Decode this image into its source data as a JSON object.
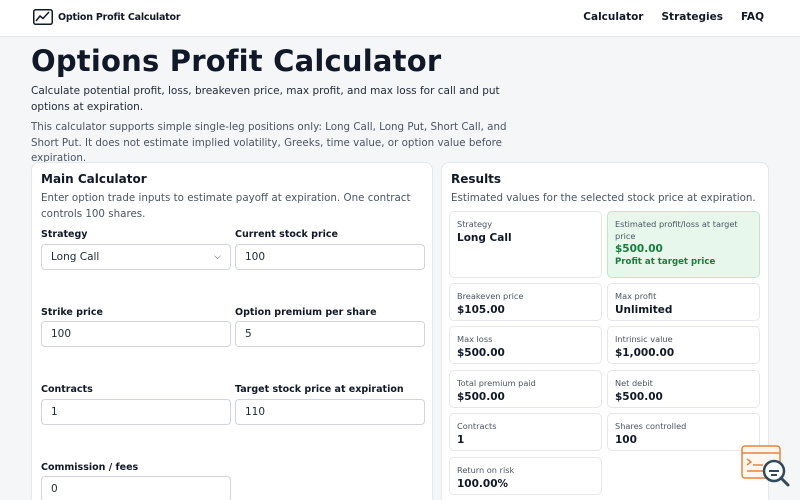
{
  "app": {
    "name": "Option Profit Calculator"
  },
  "nav": {
    "items": [
      "Calculator",
      "Strategies",
      "FAQ"
    ]
  },
  "page": {
    "title": "Options Profit Calculator",
    "intro": "Calculate potential profit, loss, breakeven price, max profit, and max loss for call and put options at expiration.",
    "note": "This calculator supports simple single-leg positions only: Long Call, Long Put, Short Call, and Short Put. It does not estimate implied volatility, Greeks, time value, or option value before expiration."
  },
  "calculator": {
    "title": "Main Calculator",
    "description": "Enter option trade inputs to estimate payoff at expiration. One contract controls 100 shares.",
    "fields": {
      "strategy": {
        "label": "Strategy",
        "value": "Long Call"
      },
      "current_price": {
        "label": "Current stock price",
        "value": "100"
      },
      "strike": {
        "label": "Strike price",
        "value": "100"
      },
      "premium": {
        "label": "Option premium per share",
        "value": "5"
      },
      "contracts": {
        "label": "Contracts",
        "value": "1"
      },
      "target_price": {
        "label": "Target stock price at expiration",
        "value": "110"
      },
      "commission": {
        "label": "Commission / fees",
        "value": "0"
      }
    }
  },
  "results": {
    "title": "Results",
    "description": "Estimated values for the selected stock price at expiration.",
    "tiles": {
      "strategy": {
        "label": "Strategy",
        "value": "Long Call"
      },
      "profit": {
        "label": "Estimated profit/loss at target price",
        "value": "$500.00",
        "sub": "Profit at target price"
      },
      "breakeven": {
        "label": "Breakeven price",
        "value": "$105.00"
      },
      "max_profit": {
        "label": "Max profit",
        "value": "Unlimited"
      },
      "max_loss": {
        "label": "Max loss",
        "value": "$500.00"
      },
      "intrinsic": {
        "label": "Intrinsic value",
        "value": "$1,000.00"
      },
      "total_premium": {
        "label": "Total premium paid",
        "value": "$500.00"
      },
      "net_debit": {
        "label": "Net debit",
        "value": "$500.00"
      },
      "contracts": {
        "label": "Contracts",
        "value": "1"
      },
      "shares": {
        "label": "Shares controlled",
        "value": "100"
      },
      "return_on_risk": {
        "label": "Return on risk",
        "value": "100.00%"
      }
    }
  },
  "colors": {
    "accent_green": "#15803d",
    "highlight_bg": "#e8f7ec",
    "help_widget": "#e8833a"
  },
  "icons": {
    "logo": "chart-logo-icon",
    "select": "chevron-down-icon",
    "help": "search-help-icon"
  }
}
